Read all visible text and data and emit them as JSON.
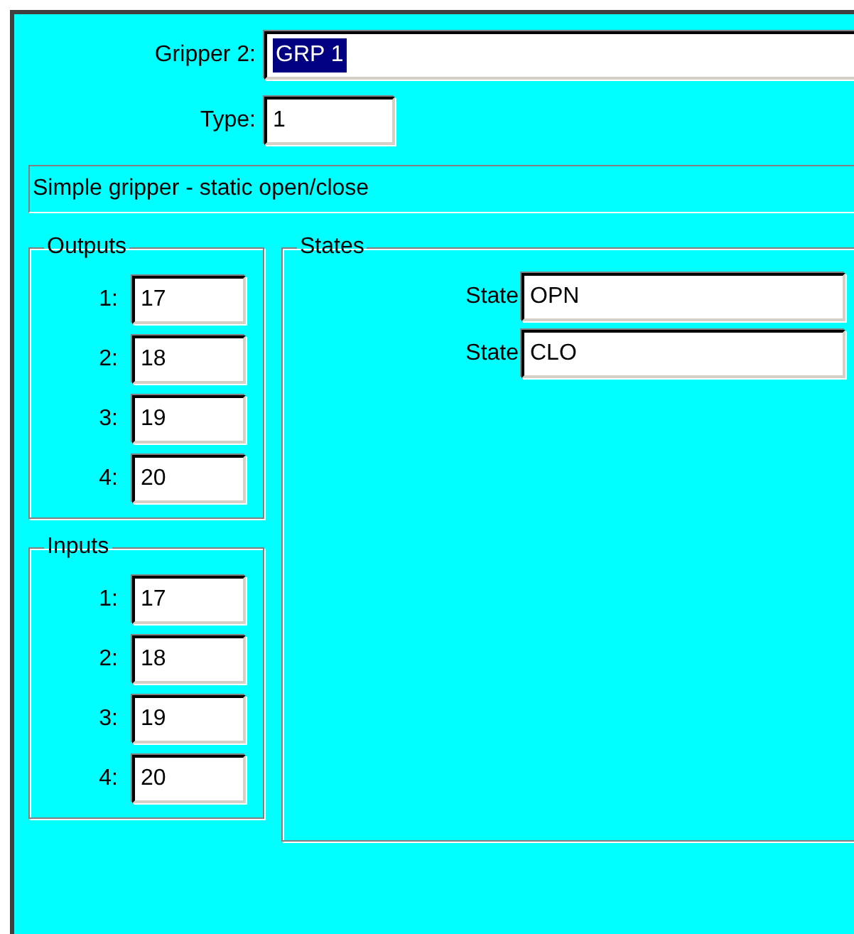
{
  "gripper": {
    "label": "Gripper 2:",
    "value": "GRP 1",
    "selected": true
  },
  "type": {
    "label": "Type:",
    "value": "1"
  },
  "description": "Simple gripper - static open/close",
  "outputs": {
    "title": "Outputs",
    "items": [
      {
        "label": "1:",
        "value": "17"
      },
      {
        "label": "2:",
        "value": "18"
      },
      {
        "label": "3:",
        "value": "19"
      },
      {
        "label": "4:",
        "value": "20"
      }
    ]
  },
  "inputs": {
    "title": "Inputs",
    "items": [
      {
        "label": "1:",
        "value": "17"
      },
      {
        "label": "2:",
        "value": "18"
      },
      {
        "label": "3:",
        "value": "19"
      },
      {
        "label": "4:",
        "value": "20"
      }
    ]
  },
  "states": {
    "title": "States",
    "items": [
      {
        "label": "State",
        "value": "OPN"
      },
      {
        "label": "State",
        "value": "CLO"
      }
    ]
  }
}
